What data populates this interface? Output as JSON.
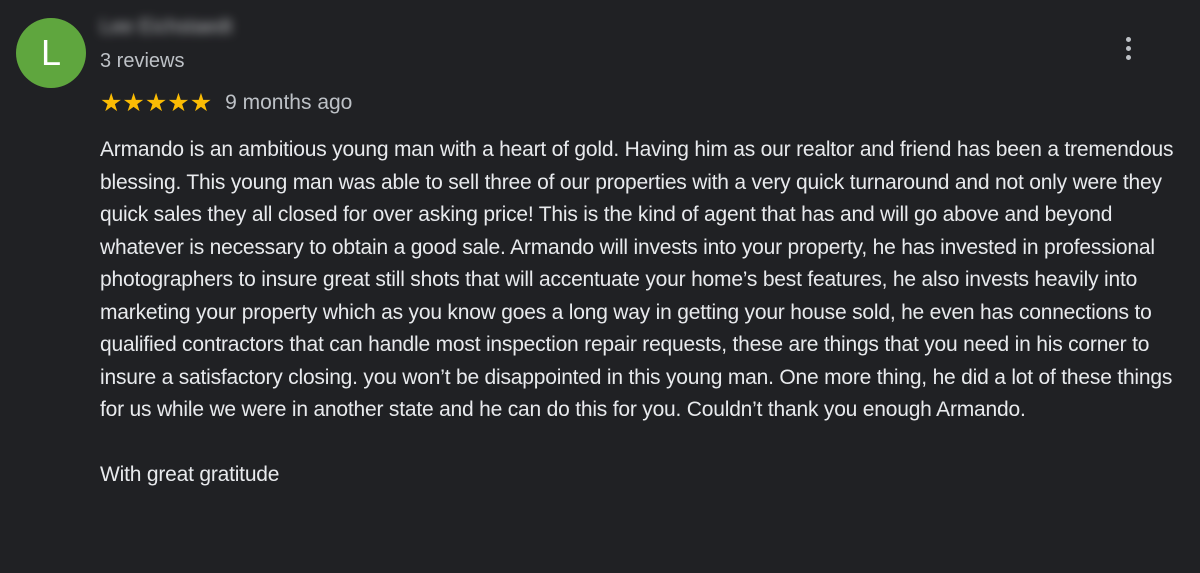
{
  "reviewer": {
    "initial": "L",
    "name": "Lee Eichstaedt",
    "review_count": "3 reviews"
  },
  "rating": {
    "stars": 5,
    "max_stars": 5,
    "star_glyph": "★",
    "star_color": "#fbbc04",
    "time_ago": "9 months ago"
  },
  "review": {
    "body": "Armando is an ambitious young man with a heart of gold. Having him as our realtor and friend has been a tremendous blessing. This young man was able to sell three of our properties with a  very quick turnaround and not only were they quick sales they all closed for over asking price! This is the kind of agent that has and will go above and beyond whatever is necessary to obtain a good sale. Armando will invests into your property, he has invested in professional photographers to insure great still shots that will accentuate your home’s best features, he also invests heavily into marketing your property which as you know goes a long way in getting your house sold, he even has connections to qualified contractors that can handle most inspection repair requests, these are things that you need in his corner to insure a satisfactory closing. you won’t be disappointed in this young man. One more thing, he did a lot of these things for us while we were in another state and he can do this for you. Couldn’t thank you enough Armando.",
    "closing": "With great gratitude"
  },
  "icons": {
    "more": "more-vert-icon"
  },
  "colors": {
    "background": "#202124",
    "avatar": "#5fa63e",
    "text": "#e8eaed",
    "secondary_text": "#bdc1c6"
  }
}
